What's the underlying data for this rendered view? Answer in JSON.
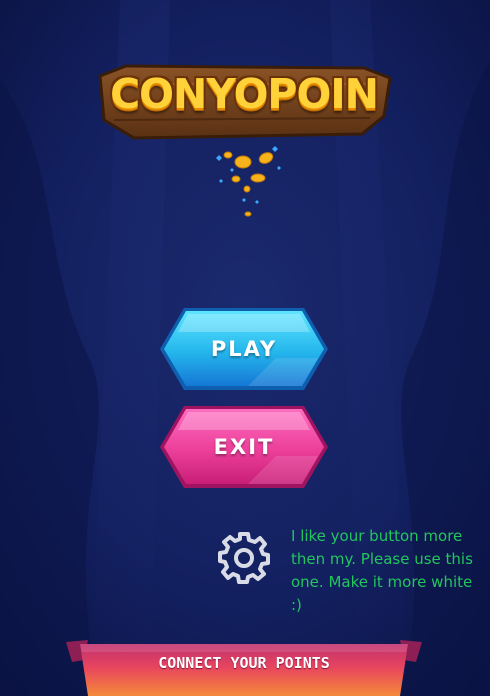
{
  "game": {
    "title": "CONYOPOIN",
    "icons": {
      "coins": "coin-burst-icon",
      "settings": "gear-icon"
    }
  },
  "menu": {
    "play_label": "PLAY",
    "exit_label": "EXIT"
  },
  "note": {
    "text": "I like your button more then my. Please use this one. Make it more white :)"
  },
  "footer": {
    "connect_label": "CONNECT YOUR POINTS"
  },
  "colors": {
    "background": "#101a4d",
    "play_button": "#26b8ea",
    "exit_button": "#ec3f9a",
    "note_text": "#22c55e",
    "banner": "#e8455e",
    "title": "#ffd23a"
  }
}
